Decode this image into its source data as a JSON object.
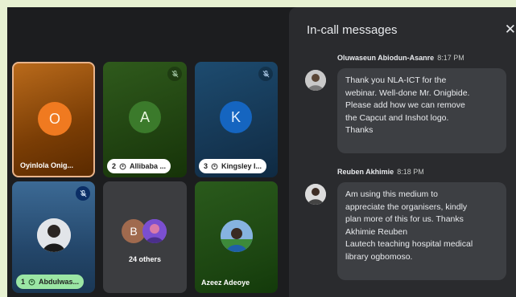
{
  "tiles": [
    {
      "name": "Oyinlola Onig...",
      "initial": "O"
    },
    {
      "name": "Allibaba ...",
      "initial": "A",
      "count": "2"
    },
    {
      "name": "Kingsley I...",
      "initial": "K",
      "count": "3"
    },
    {
      "name": "Abdulwas...",
      "count": "1"
    },
    {
      "others_label": "24 others",
      "initial": "B"
    },
    {
      "name": "Azeez Adeoye"
    }
  ],
  "panel": {
    "title": "In-call messages",
    "close": "✕"
  },
  "messages": [
    {
      "sender": "Oluwaseun Abiodun-Asanre",
      "time": "8:17 PM",
      "lines": [
        "Thank you NLA-ICT for the",
        "webinar. Well-done Mr. Onigbide.",
        "Please add how we can remove",
        "the Capcut and Inshot logo.",
        "Thanks"
      ]
    },
    {
      "sender": "Reuben Akhimie",
      "time": "8:18 PM",
      "lines": [
        "Am using this medium to",
        "appreciate the organisers, kindly",
        "plan more of this for us. Thanks",
        "Akhimie Reuben",
        "Lautech teaching hospital medical",
        "library ogbomoso."
      ]
    }
  ],
  "colors": {
    "panel_bg": "#2a2b2e",
    "bubble_bg": "#3d3f43",
    "speaking_border": "#e9b48b"
  }
}
